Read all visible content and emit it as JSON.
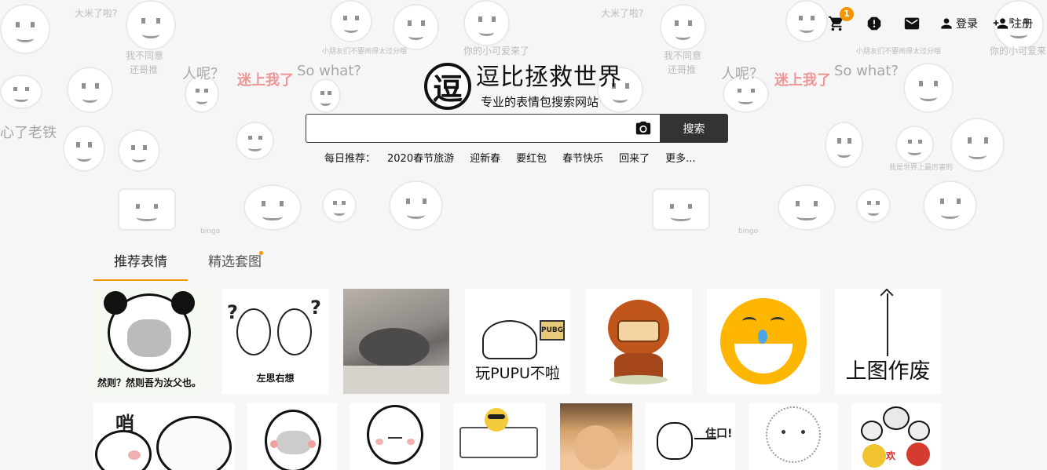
{
  "nav": {
    "cart_badge": "1",
    "login_label": "登录",
    "register_label": "注册"
  },
  "brand": {
    "mark": "逗",
    "title": "逗比拯救世界",
    "subtitle": "专业的表情包搜索网站"
  },
  "search": {
    "value": "",
    "button_label": "搜索"
  },
  "daily": {
    "label": "每日推荐：",
    "items": [
      "2020春节旅游",
      "迎新春",
      "要红包",
      "春节快乐",
      "回来了",
      "更多..."
    ]
  },
  "hero_text": [
    "我不同意",
    "还哥推",
    "人呢？",
    "迷上我了",
    "So what?",
    "你的小可爱来了",
    "心了老铁",
    "我是世界上最厉害的",
    "大米了啦?",
    "小朋友们不要闹得太过分哦",
    "bingo"
  ],
  "tabs": [
    {
      "label": "推荐表情",
      "active": true
    },
    {
      "label": "精选套图",
      "active": false,
      "dot": true
    }
  ],
  "stickers_row1": [
    {
      "caption": "然则？然则吾为汝父也。",
      "icon": "panda-meme-icon"
    },
    {
      "caption": "左思右想",
      "icon": "thinking-faces-icon"
    },
    {
      "caption": "",
      "icon": "sleeping-cat-photo"
    },
    {
      "caption": "玩PUPU不啦",
      "icon": "pubg-blob-icon"
    },
    {
      "caption": "",
      "icon": "helmet-bear-icon"
    },
    {
      "caption": "",
      "icon": "crying-smiley-icon"
    },
    {
      "caption": "上图作废",
      "icon": "arrow-up-icon"
    }
  ],
  "stickers_row2": [
    {
      "caption": "",
      "icon": "panda-bear-icon"
    },
    {
      "caption": "",
      "icon": "smirk-face-icon"
    },
    {
      "caption": "",
      "icon": "bald-face-icon"
    },
    {
      "caption": "",
      "icon": "cool-smiley-bench-icon"
    },
    {
      "caption": "",
      "icon": "cat-photo"
    },
    {
      "caption": "",
      "icon": "cat-pointing-icon"
    },
    {
      "caption": "",
      "icon": "fluffy-dog-icon"
    },
    {
      "caption": "",
      "icon": "group-meme-icon"
    }
  ]
}
